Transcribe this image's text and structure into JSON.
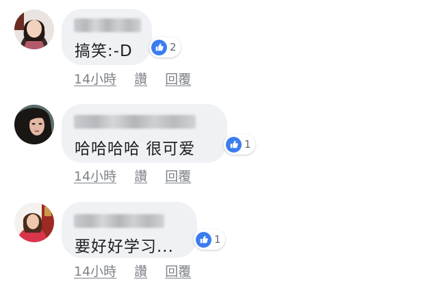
{
  "comments": [
    {
      "text": "搞笑:-D",
      "likes": "2",
      "time": "14小時",
      "like_action": "讚",
      "reply_action": "回覆"
    },
    {
      "text": "哈哈哈哈 很可爱",
      "likes": "1",
      "time": "14小時",
      "like_action": "讚",
      "reply_action": "回覆"
    },
    {
      "text": "要好好学习...",
      "likes": "1",
      "time": "14小時",
      "like_action": "讚",
      "reply_action": "回覆"
    }
  ],
  "colors": {
    "bubble": "#eff1f4",
    "like_blue": "#3b7df0",
    "muted_text": "#7d8189"
  },
  "icons": {
    "reaction": "thumbs-up-icon"
  }
}
